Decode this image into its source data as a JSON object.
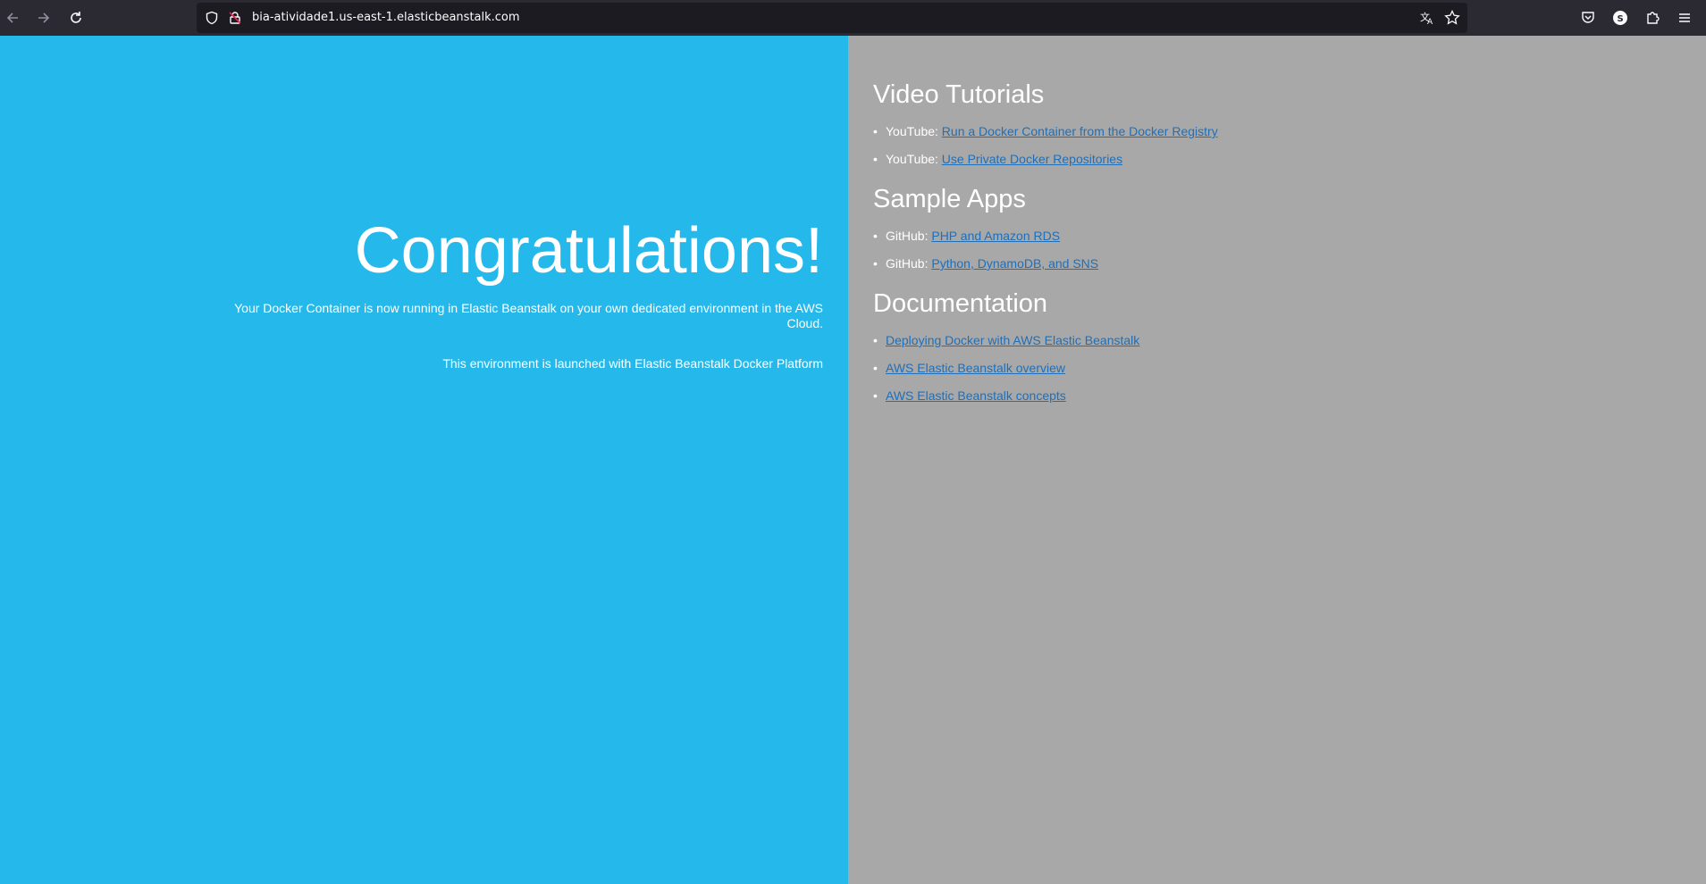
{
  "browser": {
    "url": "bia-atividade1.us-east-1.elasticbeanstalk.com"
  },
  "hero": {
    "title": "Congratulations!",
    "line1": "Your Docker Container is now running in Elastic Beanstalk on your own dedicated environment in the AWS Cloud.",
    "line2": "This environment is launched with Elastic Beanstalk Docker Platform"
  },
  "video_tutorials": {
    "title": "Video Tutorials",
    "items": [
      {
        "prefix": "YouTube:",
        "link": "Run a Docker Container from the Docker Registry"
      },
      {
        "prefix": "YouTube:",
        "link": "Use Private Docker Repositories"
      }
    ]
  },
  "sample_apps": {
    "title": "Sample Apps",
    "items": [
      {
        "prefix": "GitHub:",
        "link": "PHP and Amazon RDS"
      },
      {
        "prefix": "GitHub:",
        "link": "Python, DynamoDB, and SNS"
      }
    ]
  },
  "documentation": {
    "title": "Documentation",
    "items": [
      {
        "link": "Deploying Docker with AWS Elastic Beanstalk"
      },
      {
        "link": "AWS Elastic Beanstalk overview"
      },
      {
        "link": "AWS Elastic Beanstalk concepts"
      }
    ]
  },
  "colors": {
    "left_bg": "#24b8eb",
    "right_bg": "#a8a8a8",
    "link": "#1f6fb9",
    "toolbar": "#2b2a33"
  }
}
